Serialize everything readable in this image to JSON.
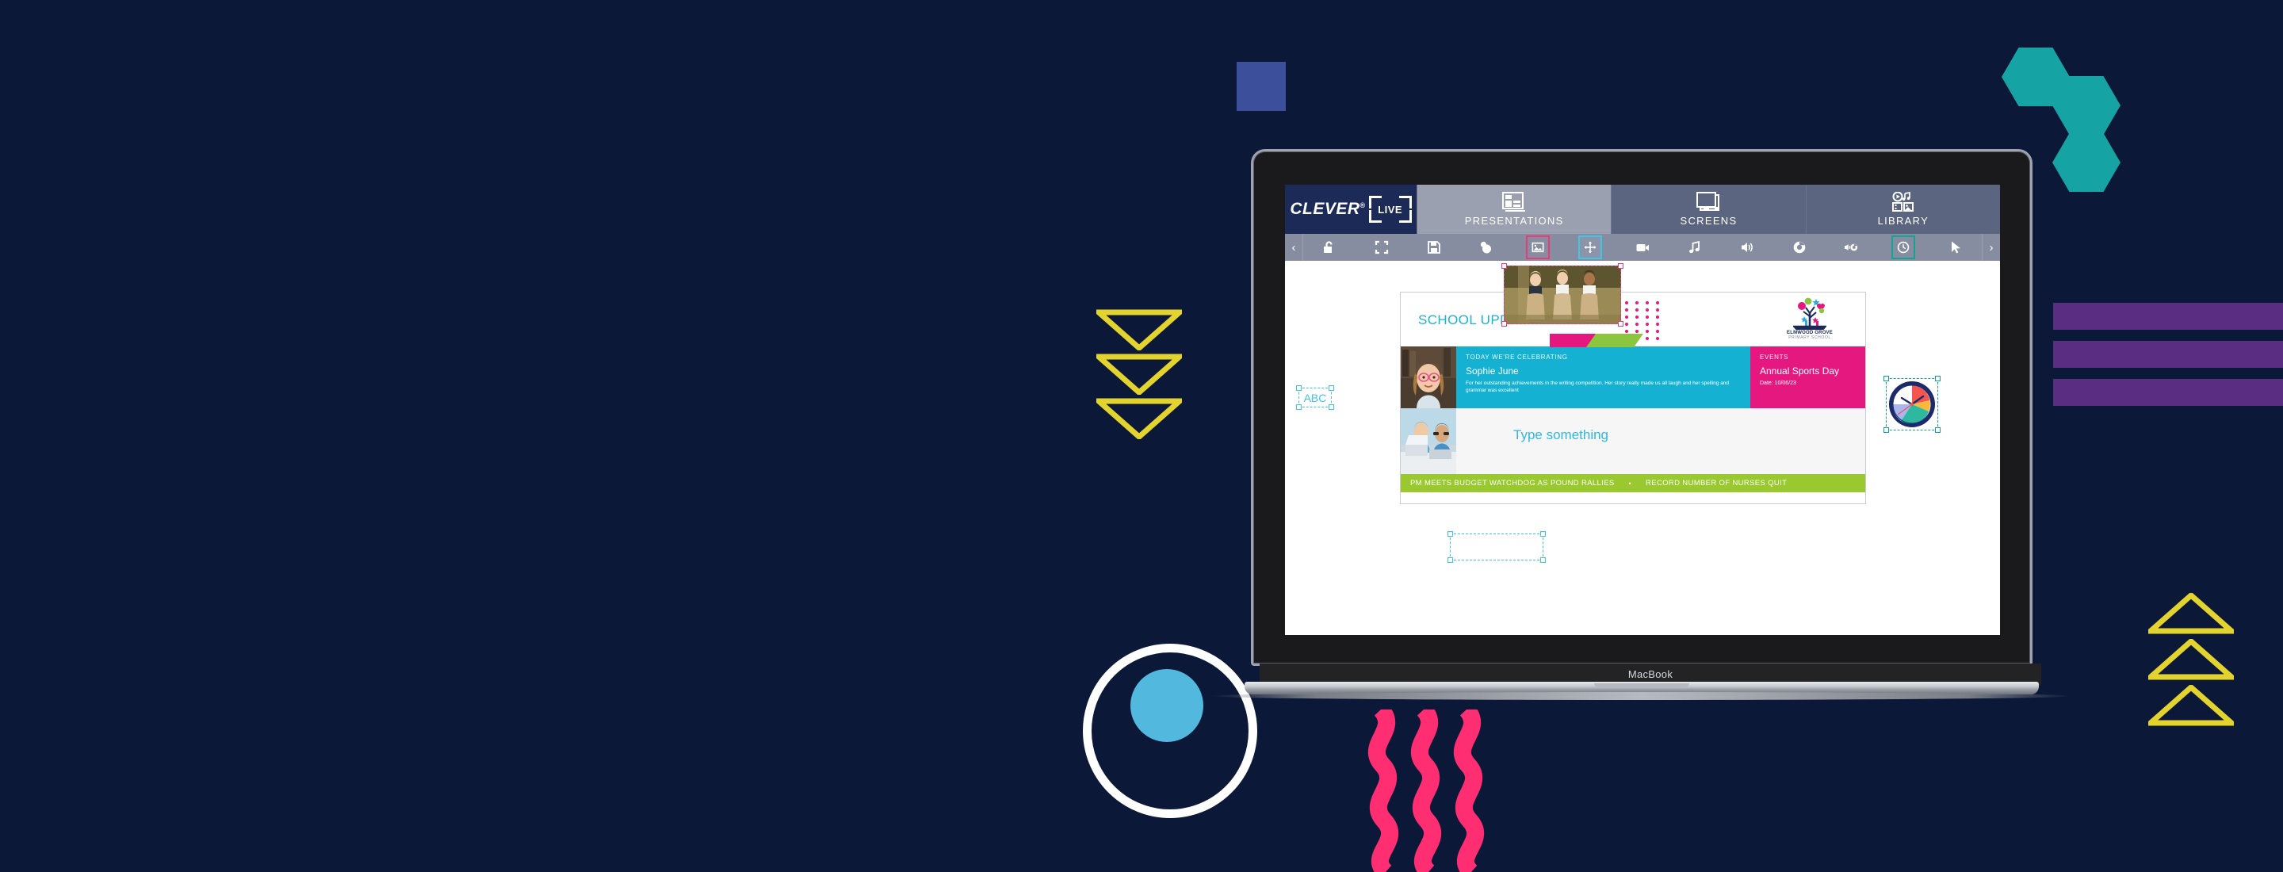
{
  "page": {
    "background_color": "#0b1838",
    "device_label": "MacBook"
  },
  "decor": {
    "square_color": "#3b4f9b",
    "hex_color": "#16a3a3",
    "purple_bar_color": "#5b2d82",
    "triangle_color": "#e3d32e",
    "ring_color": "#ffffff",
    "dot_color": "#52b8dd",
    "wave_color": "#ff2e72",
    "chevron_down_count": 3,
    "chevron_up_count": 3,
    "hex_count": 3,
    "purple_bar_count": 3,
    "wave_count": 3
  },
  "app": {
    "brand": {
      "name": "CLEVER",
      "registered": "®",
      "badge": "LIVE"
    },
    "tabs": [
      {
        "label": "PRESENTATIONS",
        "icon": "layout-icon",
        "active": true
      },
      {
        "label": "SCREENS",
        "icon": "monitor-icon",
        "active": false
      },
      {
        "label": "LIBRARY",
        "icon": "media-library-icon",
        "active": false
      }
    ],
    "toolbar": {
      "prev_label": "‹",
      "next_label": "›",
      "items": [
        {
          "name": "unlock-icon",
          "highlight": "none"
        },
        {
          "name": "fullscreen-icon",
          "highlight": "none"
        },
        {
          "name": "save-icon",
          "highlight": "none"
        },
        {
          "name": "shapes-icon",
          "highlight": "none"
        },
        {
          "name": "image-icon",
          "highlight": "pink"
        },
        {
          "name": "move-icon",
          "highlight": "cyan"
        },
        {
          "name": "video-icon",
          "highlight": "none"
        },
        {
          "name": "music-icon",
          "highlight": "none"
        },
        {
          "name": "sound-icon",
          "highlight": "none"
        },
        {
          "name": "browser-icon",
          "highlight": "none"
        },
        {
          "name": "audio-web-icon",
          "highlight": "none"
        },
        {
          "name": "clock-icon",
          "highlight": "teal"
        },
        {
          "name": "cursor-icon",
          "highlight": "none"
        }
      ]
    }
  },
  "slide": {
    "title": "SCHOOL UPDATE",
    "school": {
      "name": "ELMWOOD GROVE",
      "subtitle": "PRIMARY SCHOOL"
    },
    "celebrating": {
      "kicker": "TODAY WE'RE CELEBRATING",
      "name": "Sophie June",
      "description": "For her outstanding achievements in the writing competition. Her story really made us all laugh and her spelling and grammar was excellent"
    },
    "events": {
      "kicker": "EVENTS",
      "name": "Annual Sports Day",
      "date": "Date: 10/06/23"
    },
    "placeholder_text": "Type something",
    "abc_text": "ABC",
    "ticker": {
      "item1": "PM MEETS BUDGET WATCHDOG AS POUND RALLIES",
      "bullet": "•",
      "item2": "RECORD NUMBER OF NURSES QUIT"
    },
    "colors": {
      "cyan": "#14b1d3",
      "magenta": "#e5187f",
      "green": "#99c82f",
      "title_blue": "#1bb3d6"
    }
  },
  "chart_data": {
    "type": "pie",
    "title": "Countdown clock timer",
    "labels": [
      "Red segment",
      "Orange segment",
      "Teal segment",
      "Lavender segment",
      "White segment"
    ],
    "values": [
      22,
      11,
      25,
      17,
      25
    ],
    "colors": [
      "#f2564f",
      "#f6b councils",
      "#2fb8a0",
      "#aab6ee",
      "#ffffff"
    ],
    "rim_color": "#1b2a6b"
  }
}
